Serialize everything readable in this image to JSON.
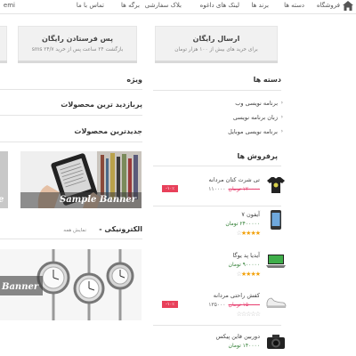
{
  "nav": {
    "items": [
      "فروشگاه",
      "دسته ها",
      "برند ها",
      "لینک های داغوه",
      "بلاک سفارشی",
      "برگه ها",
      "تماس با ما",
      "emi"
    ]
  },
  "features": [
    {
      "title": "ارسال رایگان",
      "subtitle": "برای خرید های بیش از ۱۰۰ هزار تومان"
    },
    {
      "title": "پس فرستادن رایگان",
      "subtitle": "بازگشت ۲۴ ساعت پس از خرید ۲۴/۷ sms"
    }
  ],
  "sidebar": {
    "categories_title": "دسته ها",
    "categories": [
      "برنامه نویسی وب",
      "زبان برنامه نویسی",
      "برنامه نویسی موبایل"
    ],
    "bestsellers_title": "پرفروش ها",
    "products": [
      {
        "name": "تی شرت کتان مردانه",
        "old_price": "۱۲۰۰۰۰ تومان",
        "new_price": "۱۱۰۰۰۰",
        "stars": 0,
        "sale": "۱۰٪-"
      },
      {
        "name": "آیفون ۷",
        "price": "۲۴۰۰۰۰۰ تومان",
        "stars": 4,
        "sale": ""
      },
      {
        "name": "آیدیا پد یوگا",
        "price": "۹۰۰۰۰۰ تومان",
        "stars": 4,
        "sale": ""
      },
      {
        "name": "کفش راحتی مردانه",
        "old_price": "۱۵۰۰۰۰ تومان",
        "new_price": "۱۳۵۰۰۰",
        "stars": 0,
        "sale": "۱۰٪-"
      },
      {
        "name": "دوربین فاین پیکس",
        "price": "۱۴۰۰۰۰ تومان",
        "stars": 0,
        "sale": ""
      }
    ]
  },
  "main": {
    "special_title": "ویژه",
    "most_viewed_title": "پربازدید ترین محصولات",
    "newest_title": "جدیدترین محصولات",
    "banner_caption": "Sample Banner",
    "electronics_title": "الکترونیکی -",
    "electronics_more": "نمایش همه",
    "banner2_caption": "Banner"
  },
  "colors": {
    "accent": "#e8405a",
    "star": "#f2a10b",
    "price_green": "#2e7d32"
  }
}
